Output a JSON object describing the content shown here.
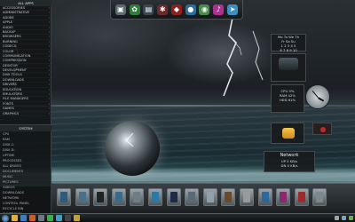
{
  "sidebar": {
    "top_header": "ALL APPS",
    "items": [
      "ACCESSORIES",
      "ADMINISTRATIVE",
      "ADOBE",
      "APPLE",
      "AUDIO",
      "BACKUP",
      "BROWSERS",
      "BURNING",
      "CODECS",
      "COLOR",
      "COMMUNICATION",
      "COMPRESSION",
      "DESKTOP",
      "DEVELOPMENT",
      "DISK TOOLS",
      "DOWNLOADS",
      "DRIVERS",
      "EDUCATION",
      "EMULATORS",
      "FILE MANAGERS",
      "FONTS",
      "GAMES",
      "GRAPHICS",
      "INTERNET",
      "MAINTENANCE",
      "MEDIA",
      "MICROSOFT",
      "MONITORING",
      "NETWORK",
      "OFFICE",
      "PHOTO",
      "PLAYERS",
      "PORTABLE",
      "PROGRAMMING",
      "RECOVERY",
      "SECURITY",
      "STARTUP",
      "SYSTEM",
      "TWEAKS",
      "UTILITIES",
      "VIDEO",
      "VIRTUAL",
      "WALLPAPERS",
      "WEB",
      "WIDGETS",
      "WINDOWS"
    ],
    "bottom_header": "SYSTEM",
    "stats": [
      "CPU",
      "RAM",
      "DISK C:",
      "DISK D:",
      "UPTIME",
      "PROCESSES",
      "ALL DRIVES",
      "DOCUMENTS",
      "MUSIC",
      "PICTURES",
      "VIDEOS",
      "DOWNLOADS",
      "NETWORK",
      "CONTROL PANEL",
      "RECYCLE BIN",
      "SHUTDOWN"
    ]
  },
  "topdock": {
    "icons": [
      {
        "name": "computer-icon",
        "color": "#5c6a72",
        "glyph": "▣"
      },
      {
        "name": "leaf-icon",
        "color": "#2f7d3a",
        "glyph": "✿"
      },
      {
        "name": "display-icon",
        "color": "#3a4650",
        "glyph": "▤"
      },
      {
        "name": "palette-icon",
        "color": "#6b2a2a",
        "glyph": "✱"
      },
      {
        "name": "shield-icon",
        "color": "#8f1f1f",
        "glyph": "◆"
      },
      {
        "name": "globe-icon",
        "color": "#2a6f9a",
        "glyph": "●"
      },
      {
        "name": "ball-icon",
        "color": "#4a8a4a",
        "glyph": "◉"
      },
      {
        "name": "music-icon",
        "color": "#b03090",
        "glyph": "♪"
      },
      {
        "name": "bird-icon",
        "color": "#3a8fc4",
        "glyph": "➤"
      }
    ]
  },
  "rightwidgets": {
    "calendar_title": "",
    "calendar_rows": [
      "Mo Tu We Th",
      "Fr Sa Su",
      "1 2 3 4 5",
      "6 7 8 9 10"
    ],
    "weather_label": "",
    "system_lines": [
      "CPU 0%",
      "RAM 42%",
      "HDD 61%"
    ],
    "network_label": "Network",
    "network_lines": [
      "UP 0 KB/s",
      "DN 0 KB/s"
    ]
  },
  "launcher": {
    "icons": [
      {
        "name": "folder-icon",
        "color": "#2f5a7a"
      },
      {
        "name": "window-icon",
        "color": "#4a6f88"
      },
      {
        "name": "music-player-icon",
        "color": "#222"
      },
      {
        "name": "image-icon",
        "color": "#3a6a8a"
      },
      {
        "name": "video-icon",
        "color": "#6f7d85"
      },
      {
        "name": "camera-icon",
        "color": "#2a7aa8"
      },
      {
        "name": "game-icon",
        "color": "#1f2a44"
      },
      {
        "name": "tools-icon",
        "color": "#5a6a74"
      },
      {
        "name": "document-icon",
        "color": "#8fa0aa"
      },
      {
        "name": "disc-icon",
        "color": "#6a4a2a"
      },
      {
        "name": "download-icon",
        "color": "#9a9a9a"
      },
      {
        "name": "globe-icon",
        "color": "#2a6a9a"
      },
      {
        "name": "paint-icon",
        "color": "#8a2a6a"
      },
      {
        "name": "mail-icon",
        "color": "#a02a2a"
      },
      {
        "name": "trash-icon",
        "color": "#7d878c"
      }
    ]
  },
  "taskbar": {
    "icons": [
      {
        "name": "explorer-icon",
        "color": "#e0b13a"
      },
      {
        "name": "browser-icon",
        "color": "#3a7fc4"
      },
      {
        "name": "media-icon",
        "color": "#d05a2a"
      },
      {
        "name": "settings-icon",
        "color": "#6a7a84"
      },
      {
        "name": "chat-icon",
        "color": "#3ab04a"
      },
      {
        "name": "photo-icon",
        "color": "#3aa0c4"
      },
      {
        "name": "terminal-icon",
        "color": "#444"
      },
      {
        "name": "notes-icon",
        "color": "#c4a03a"
      }
    ],
    "tray_text": "",
    "tray_icons": [
      {
        "name": "volume-icon",
        "color": "#9aa5aa"
      },
      {
        "name": "network-tray-icon",
        "color": "#7aa5c4"
      },
      {
        "name": "battery-icon",
        "color": "#6ab04a"
      }
    ]
  }
}
